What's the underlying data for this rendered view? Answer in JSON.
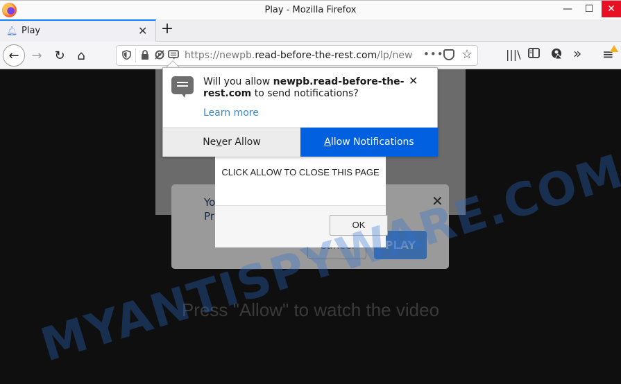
{
  "window": {
    "title": "Play - Mozilla Firefox",
    "minimize": "—",
    "maximize": "☐",
    "close": "✕"
  },
  "tabs": [
    {
      "label": "Play",
      "icon": "bell-icon",
      "active": true
    }
  ],
  "tabbar": {
    "new_tab": "+",
    "tab_close": "✕"
  },
  "nav": {
    "back": "←",
    "forward": "→",
    "reload": "↻",
    "home": "⌂"
  },
  "urlbar": {
    "scheme": "https://newpb.",
    "host": "read-before-the-rest.com",
    "path": "/lp/new",
    "more": "•••",
    "star": "☆"
  },
  "toolbar_icons": [
    "library-icon",
    "sidebar-icon",
    "account-warning-icon",
    "overflow-icon",
    "menu-icon"
  ],
  "toolbar": {
    "library": "|||\\",
    "sidebar": "▥",
    "account": "◕",
    "overflow": "»",
    "menu": "≡"
  },
  "notification": {
    "prefix": "Will you allow ",
    "site": "newpb.read-before-the-rest.com",
    "suffix": " to send notifications?",
    "learn_more": "Learn more",
    "close": "✕",
    "never_pre": "Ne",
    "never_u": "v",
    "never_post": "er Allow",
    "allow_u": "A",
    "allow_post": "llow Notifications",
    "accent": "#0060df"
  },
  "alert": {
    "message": "CLICK ALLOW TO CLOSE THIS PAGE",
    "ok": "OK"
  },
  "background_modal": {
    "line1": "Yo",
    "line2": "Pr",
    "close": "✕",
    "cancel": "Cancel",
    "play": "PLAY"
  },
  "page": {
    "press_allow": "Press \"Allow\" to watch the video"
  },
  "watermark": {
    "text": "MYANTISPYWARE.COM"
  }
}
